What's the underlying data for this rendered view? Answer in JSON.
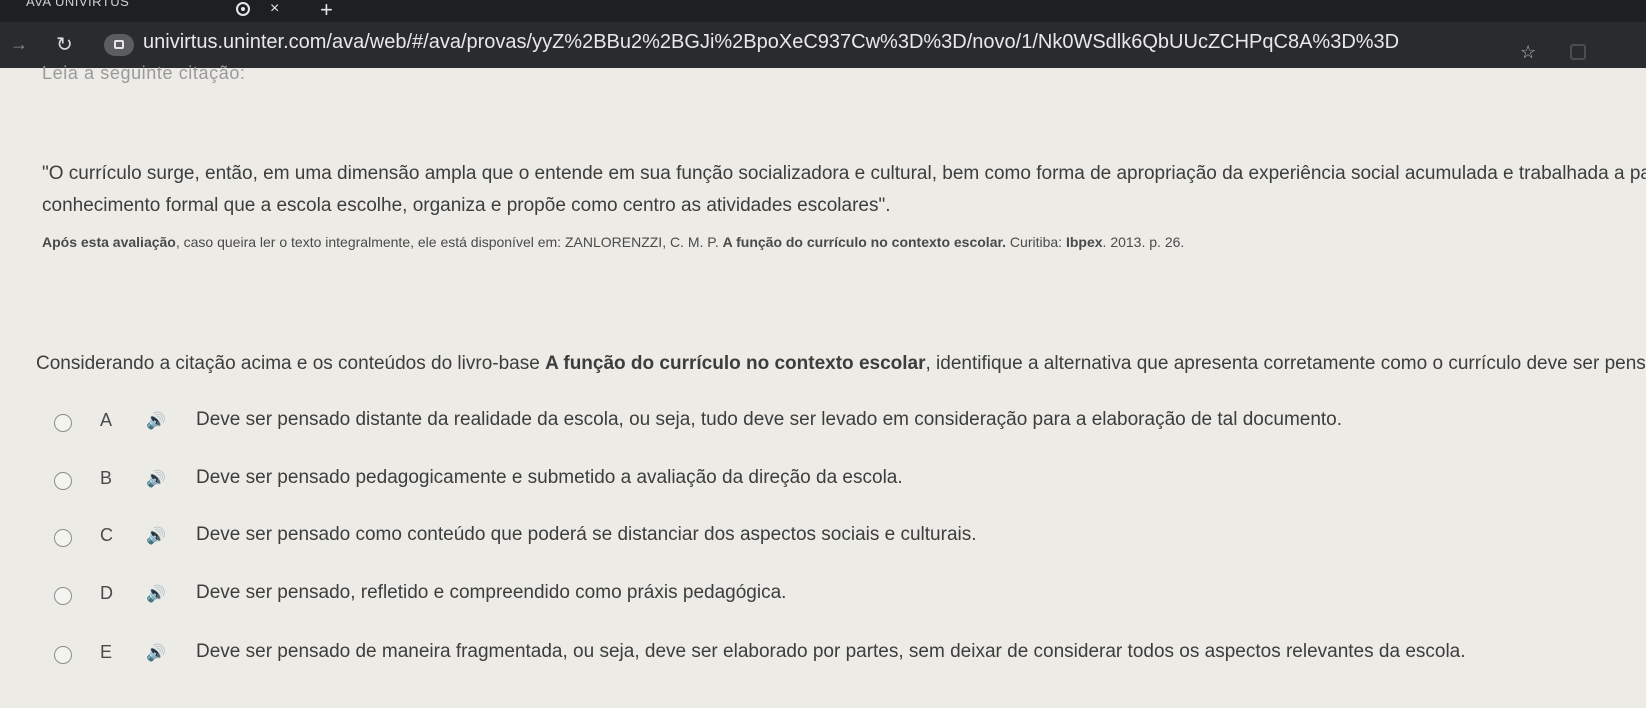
{
  "browser": {
    "tab_title": "AVA UNIVIRTUS",
    "close_glyph": "×",
    "new_tab_glyph": "+",
    "url": "univirtus.uninter.com/ava/web/#/ava/provas/yyZ%2BBu2%2BGJi%2BpoXeC937Cw%3D%3D/novo/1/Nk0WSdlk6QbUUcZCHPqC8A%3D%3D"
  },
  "page": {
    "lead_in": "Leia a seguinte citação:",
    "quote_lines": [
      "\"O currículo surge, então, em uma dimensão ampla que o entende em sua função socializadora e cultural, bem como forma de apropriação da experiência social acumulada e trabalhada a partir",
      "conhecimento formal que a escola escolhe, organiza e propõe como centro as atividades escolares\"."
    ],
    "source": {
      "prefix": "Após esta avaliação",
      "text": ", caso queira ler o texto integralmente, ele está disponível em: ZANLORENZZI, C. M. P. ",
      "book_title": "A função do currículo no contexto escolar.",
      "publisher_prefix": " Curitiba: ",
      "publisher": "Ibpex",
      "tail": ". 2013. p. 26."
    },
    "question": {
      "intro": "Considerando a citação acima e os conteúdos do livro-base ",
      "book": "A função do currículo no contexto escolar",
      "rest": ", identifique a alternativa que apresenta corretamente como o currículo deve ser pensado."
    },
    "options": [
      {
        "letter": "A",
        "text": "Deve ser pensado distante da realidade da escola, ou seja, tudo deve ser levado em consideração para a elaboração de tal documento."
      },
      {
        "letter": "B",
        "text": "Deve ser pensado pedagogicamente e submetido a avaliação da direção da escola."
      },
      {
        "letter": "C",
        "text": "Deve ser pensado como conteúdo que poderá  se distanciar dos aspectos sociais e culturais."
      },
      {
        "letter": "D",
        "text": "Deve ser pensado, refletido e compreendido como práxis pedagógica."
      },
      {
        "letter": "E",
        "text": "Deve ser pensado de maneira fragmentada, ou seja, deve ser elaborado por partes, sem deixar de considerar todos os aspectos relevantes da escola."
      }
    ],
    "speaker_glyph": "🔊"
  }
}
